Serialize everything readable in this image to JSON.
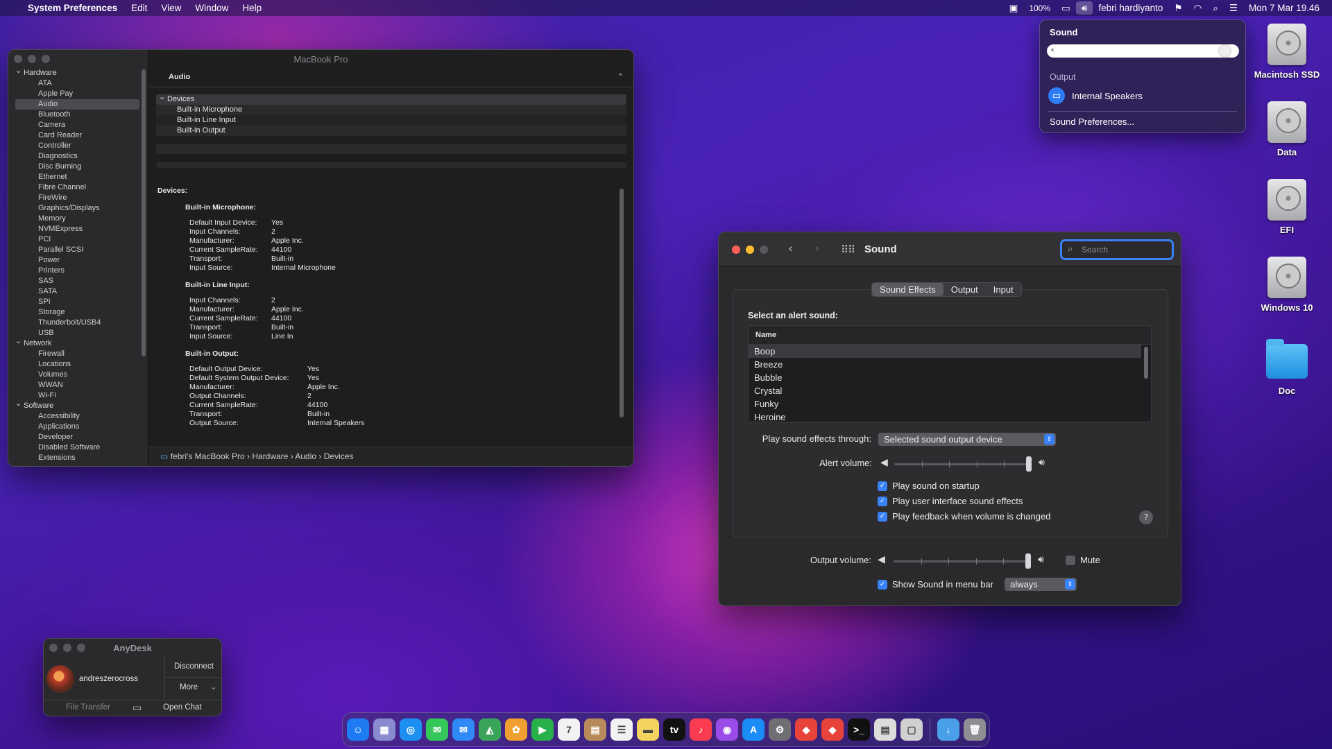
{
  "menubar": {
    "apple": "",
    "app": "System Preferences",
    "menus": [
      "Edit",
      "View",
      "Window",
      "Help"
    ],
    "battery": "100%",
    "user": "febri hardiyanto",
    "datetime": "Mon 7 Mar  19.46"
  },
  "sysinfo": {
    "title": "MacBook Pro",
    "sidebar": {
      "hardware_label": "Hardware",
      "hardware": [
        "ATA",
        "Apple Pay",
        "Audio",
        "Bluetooth",
        "Camera",
        "Card Reader",
        "Controller",
        "Diagnostics",
        "Disc Burning",
        "Ethernet",
        "Fibre Channel",
        "FireWire",
        "Graphics/Displays",
        "Memory",
        "NVMExpress",
        "PCI",
        "Parallel SCSI",
        "Power",
        "Printers",
        "SAS",
        "SATA",
        "SPI",
        "Storage",
        "Thunderbolt/USB4",
        "USB"
      ],
      "network_label": "Network",
      "network": [
        "Firewall",
        "Locations",
        "Volumes",
        "WWAN",
        "Wi-Fi"
      ],
      "software_label": "Software",
      "software": [
        "Accessibility",
        "Applications",
        "Developer",
        "Disabled Software",
        "Extensions"
      ]
    },
    "section": "Audio",
    "devices_header": "Devices",
    "device_list": [
      "Built-in Microphone",
      "Built-in Line Input",
      "Built-in Output"
    ],
    "detail": {
      "heading": "Devices:",
      "mic": {
        "title": "Built-in Microphone:",
        "rows": [
          [
            "Default Input Device:",
            "Yes"
          ],
          [
            "Input Channels:",
            "2"
          ],
          [
            "Manufacturer:",
            "Apple Inc."
          ],
          [
            "Current SampleRate:",
            "44100"
          ],
          [
            "Transport:",
            "Built-in"
          ],
          [
            "Input Source:",
            "Internal Microphone"
          ]
        ]
      },
      "line": {
        "title": "Built-in Line Input:",
        "rows": [
          [
            "Input Channels:",
            "2"
          ],
          [
            "Manufacturer:",
            "Apple Inc."
          ],
          [
            "Current SampleRate:",
            "44100"
          ],
          [
            "Transport:",
            "Built-in"
          ],
          [
            "Input Source:",
            "Line In"
          ]
        ]
      },
      "out": {
        "title": "Built-in Output:",
        "rows": [
          [
            "Default Output Device:",
            "Yes"
          ],
          [
            "Default System Output Device:",
            "Yes"
          ],
          [
            "Manufacturer:",
            "Apple Inc."
          ],
          [
            "Output Channels:",
            "2"
          ],
          [
            "Current SampleRate:",
            "44100"
          ],
          [
            "Transport:",
            "Built-in"
          ],
          [
            "Output Source:",
            "Internal Speakers"
          ]
        ]
      }
    },
    "path": [
      "febri's MacBook Pro",
      "Hardware",
      "Audio",
      "Devices"
    ]
  },
  "sound_popup": {
    "title": "Sound",
    "volume": 0.96,
    "output_label": "Output",
    "device": "Internal Speakers",
    "prefs_link": "Sound Preferences..."
  },
  "desktop": [
    "Macintosh SSD",
    "Data",
    "EFI",
    "Windows 10",
    "Doc"
  ],
  "sound_window": {
    "title": "Sound",
    "search_placeholder": "Search",
    "tabs": [
      "Sound Effects",
      "Output",
      "Input"
    ],
    "active_tab": "Sound Effects",
    "alert_label": "Select an alert sound:",
    "list_header": "Name",
    "alerts": [
      "Boop",
      "Breeze",
      "Bubble",
      "Crystal",
      "Funky",
      "Heroine"
    ],
    "selected_alert": "Boop",
    "through_label": "Play sound effects through:",
    "through_value": "Selected sound output device",
    "alert_volume_label": "Alert volume:",
    "alert_volume": 1.0,
    "checks": [
      {
        "label": "Play sound on startup",
        "checked": true
      },
      {
        "label": "Play user interface sound effects",
        "checked": true
      },
      {
        "label": "Play feedback when volume is changed",
        "checked": true
      }
    ],
    "help": "?",
    "output_volume_label": "Output volume:",
    "output_volume": 1.0,
    "mute_label": "Mute",
    "show_menu_label": "Show Sound in menu bar",
    "show_menu_value": "always"
  },
  "anydesk": {
    "title": "AnyDesk",
    "user": "andreszerocross",
    "disconnect": "Disconnect",
    "more": "More",
    "file_transfer": "File Transfer",
    "open_chat": "Open Chat"
  },
  "dock": [
    "Finder",
    "Launchpad",
    "Safari",
    "Messages",
    "Mail",
    "Maps",
    "Photos",
    "FaceTime",
    "Calendar",
    "Contacts",
    "Reminders",
    "Notes",
    "TV",
    "Music",
    "Podcasts",
    "App Store",
    "System Preferences",
    "AnyDesk",
    "AnyDesk",
    "Terminal",
    "Preview",
    "Installer",
    "Downloads",
    "Trash"
  ],
  "colors": {
    "accent": "#3a82f7",
    "close": "#fe5f57",
    "minimize": "#febc2e"
  }
}
